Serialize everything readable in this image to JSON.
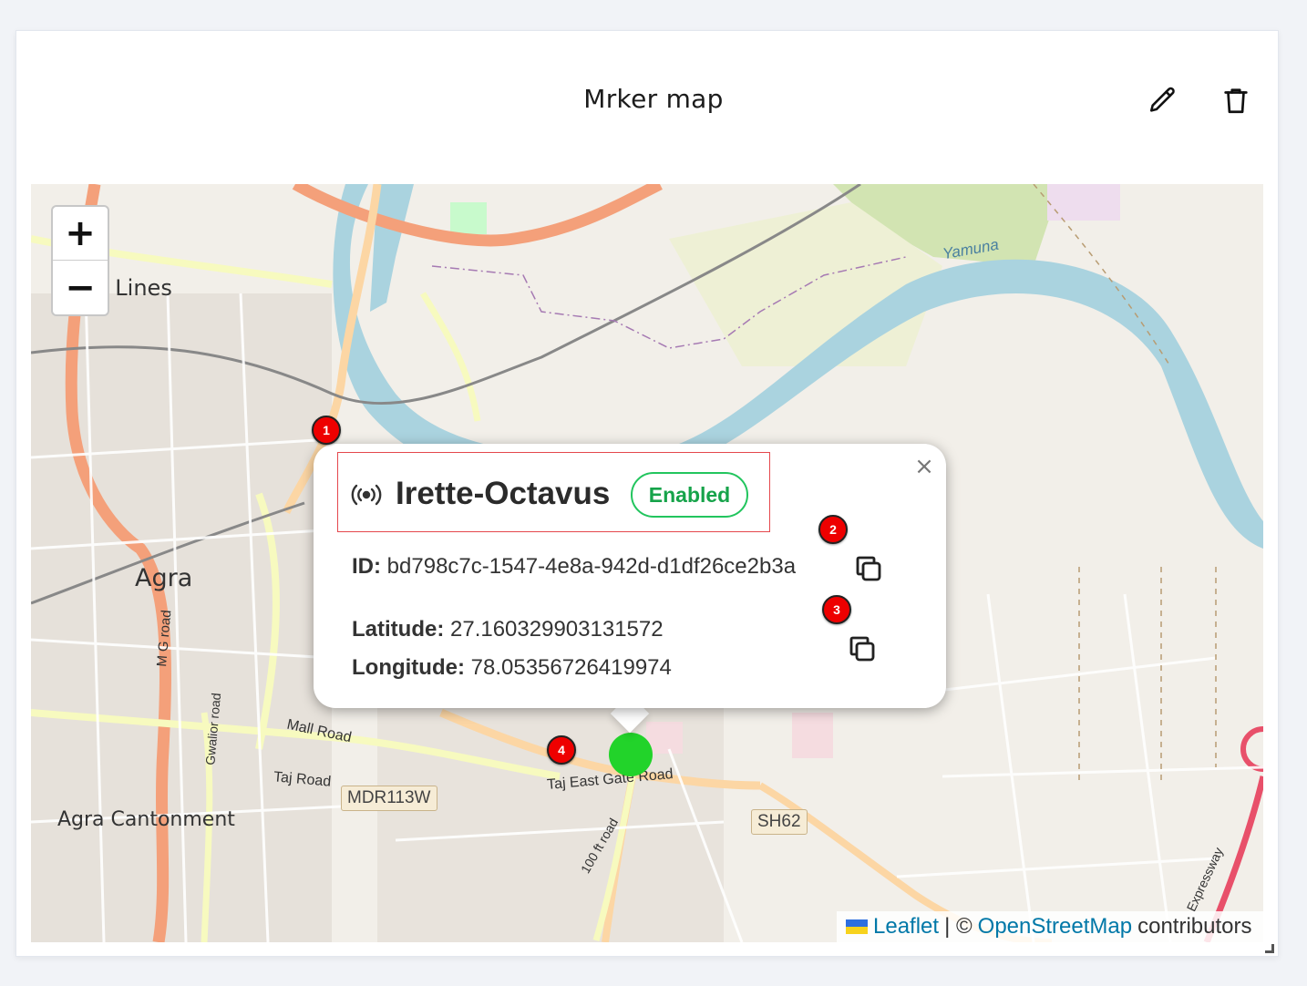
{
  "card": {
    "title": "Mrker map"
  },
  "icons": {
    "edit": "pencil-icon",
    "delete": "trash-icon",
    "device": "broadcast-icon",
    "copy": "copy-icon",
    "close": "close-icon"
  },
  "map": {
    "zoom_in_label": "+",
    "zoom_out_label": "−",
    "labels": {
      "civil_lines": "l Lines",
      "agra": "Agra",
      "agra_cantonment": "Agra Cantonment",
      "yamuna": "Yamuna",
      "m_g_road": "M G road",
      "gwalior_road": "Gwalior road",
      "mall_road": "Mall Road",
      "taj_road": "Taj Road",
      "taj_east_gate_road": "Taj East Gate Road",
      "ft_road": "100 ft road",
      "mdr": "MDR113W",
      "sh62": "SH62",
      "expressway": "Expressway"
    },
    "attribution": {
      "leaflet": "Leaflet",
      "separator": "| ©",
      "osm": "OpenStreetMap",
      "contributors": "contributors"
    }
  },
  "popup": {
    "close_label": "×",
    "device_name": "Irette-Octavus",
    "status": "Enabled",
    "id_label": "ID:",
    "id_value": "bd798c7c-1547-4e8a-942d-d1df26ce2b3a",
    "latitude_label": "Latitude:",
    "latitude_value": "27.160329903131572",
    "longitude_label": "Longitude:",
    "longitude_value": "78.05356726419974"
  },
  "callouts": [
    "1",
    "2",
    "3",
    "4"
  ],
  "colors": {
    "accent_green": "#22c55e",
    "marker": "#22d32a",
    "callout_red": "#e00000",
    "river": "#aad3df",
    "primary_road": "#f4a07a",
    "secondary_road": "#f7fabf"
  }
}
